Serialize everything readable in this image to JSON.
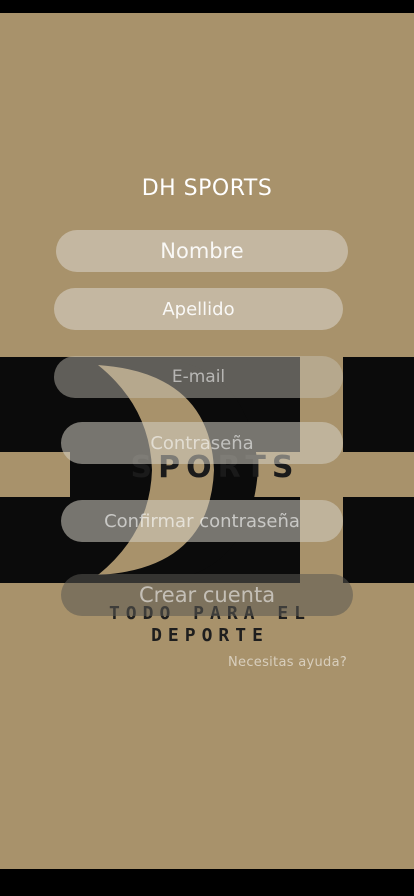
{
  "app": {
    "title": "DH SPORTS"
  },
  "logo": {
    "letters": "DH",
    "sports": "SPORTS",
    "tagline_1": "TODO PARA EL",
    "tagline_2": "DEPORTE"
  },
  "form": {
    "nombre_placeholder": "Nombre",
    "apellido_placeholder": "Apellido",
    "email_placeholder": "E-mail",
    "password_placeholder": "Contraseña",
    "confirm_placeholder": "Confirmar contraseña",
    "create_label": "Crear cuenta",
    "help_label": "Necesitas ayuda?"
  },
  "colors": {
    "background": "#a8926b",
    "logo": "#0b0b0b",
    "text": "#ffffff"
  }
}
